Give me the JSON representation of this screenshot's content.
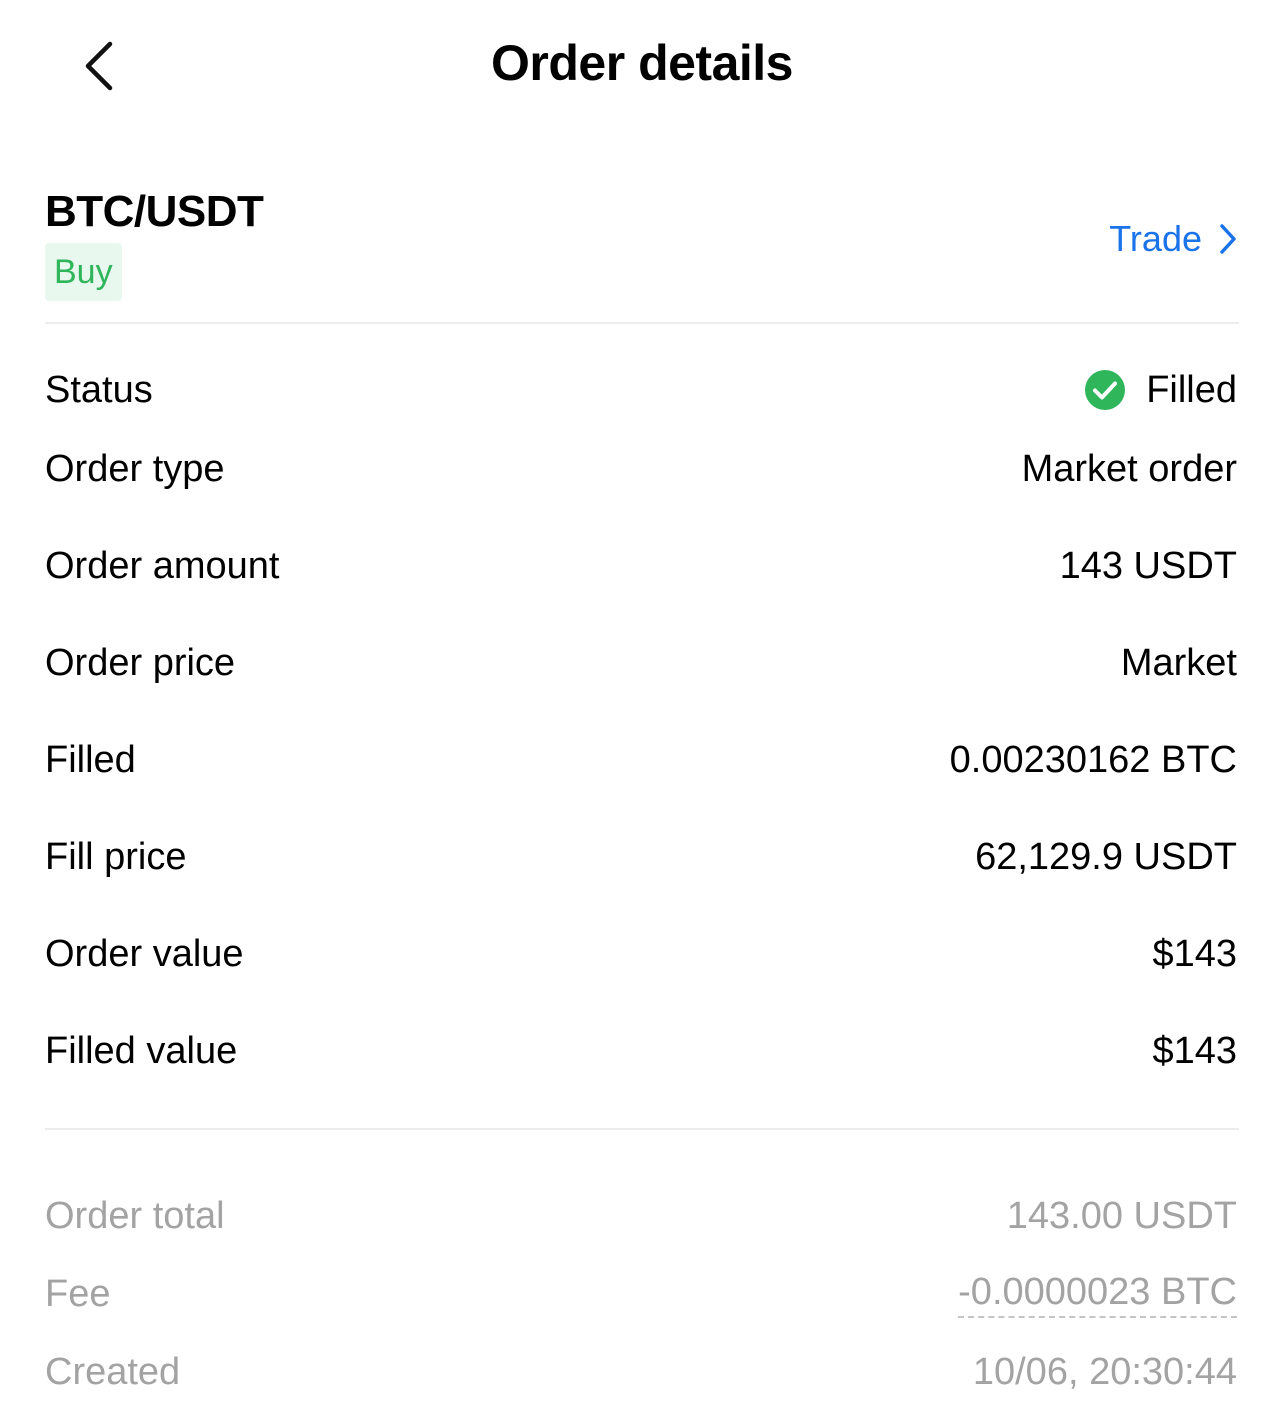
{
  "header": {
    "title": "Order details"
  },
  "pair": {
    "name": "BTC/USDT",
    "side": "Buy",
    "trade_label": "Trade"
  },
  "details": [
    {
      "label": "Status",
      "value": "Filled"
    },
    {
      "label": "Order type",
      "value": "Market order"
    },
    {
      "label": "Order amount",
      "value": "143 USDT"
    },
    {
      "label": "Order price",
      "value": "Market"
    },
    {
      "label": "Filled",
      "value": "0.00230162 BTC"
    },
    {
      "label": "Fill price",
      "value": "62,129.9 USDT"
    },
    {
      "label": "Order value",
      "value": "$143"
    },
    {
      "label": "Filled value",
      "value": "$143"
    }
  ],
  "summary": [
    {
      "label": "Order total",
      "value": "143.00 USDT"
    },
    {
      "label": "Fee",
      "value": "-0.0000023 BTC"
    },
    {
      "label": "Created",
      "value": "10/06, 20:30:44"
    }
  ],
  "colors": {
    "accent": "#1a73e8",
    "buy": "#2fb55a",
    "status_filled": "#2fb55a",
    "muted_text": "#a3a3a3"
  },
  "icons": {
    "back": "chevron-left-icon",
    "trade": "chevron-right-icon",
    "status": "check-circle-icon"
  }
}
